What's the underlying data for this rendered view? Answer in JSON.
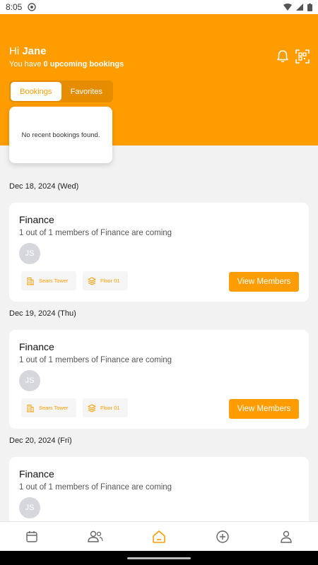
{
  "status": {
    "time": "8:05"
  },
  "header": {
    "greeting_prefix": "Hi",
    "user_name": "Jane",
    "sub_prefix": "You have",
    "sub_count": "0 upcoming bookings",
    "notification_icon": "bell-icon",
    "scan_icon": "qr-scan-icon"
  },
  "tabs": [
    {
      "label": "Bookings",
      "active": true
    },
    {
      "label": "Favorites",
      "active": false
    }
  ],
  "recent": {
    "empty_text": "No recent bookings found."
  },
  "days": [
    {
      "date": "Dec 18, 2024 (Wed)",
      "booking": {
        "title": "Finance",
        "subtitle": "1 out of 1 members of Finance are coming",
        "avatar": "JS",
        "building": "Sears Tower",
        "floor": "Floor 01",
        "button": "View Members"
      }
    },
    {
      "date": "Dec 19, 2024 (Thu)",
      "booking": {
        "title": "Finance",
        "subtitle": "1 out of 1 members of Finance are coming",
        "avatar": "JS",
        "building": "Sears Tower",
        "floor": "Floor 01",
        "button": "View Members"
      }
    },
    {
      "date": "Dec 20, 2024 (Fri)",
      "booking": {
        "title": "Finance",
        "subtitle": "1 out of 1 members of Finance are coming",
        "avatar": "JS"
      }
    }
  ],
  "nav": [
    {
      "icon": "calendar-icon",
      "active": false
    },
    {
      "icon": "people-icon",
      "active": false
    },
    {
      "icon": "home-icon",
      "active": true
    },
    {
      "icon": "plus-circle-icon",
      "active": false
    },
    {
      "icon": "profile-icon",
      "active": false
    }
  ],
  "colors": {
    "accent": "#fe9c00",
    "accent_dark": "#e58c00",
    "background": "#f2f2f2"
  }
}
